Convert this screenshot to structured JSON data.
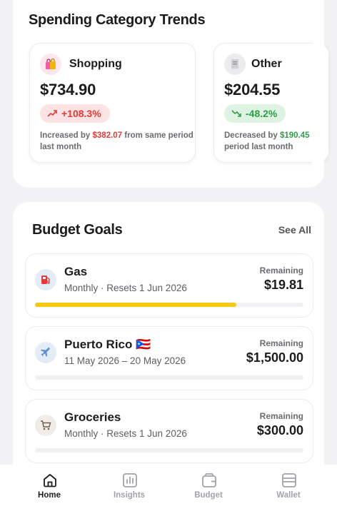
{
  "trends": {
    "title": "Spending Category Trends",
    "cards": [
      {
        "name": "Shopping",
        "icon": "shopping-bags-icon",
        "amount": "$734.90",
        "change": "+108.3%",
        "direction": "up",
        "desc_prefix": "Increased by ",
        "desc_amount": "$382.07",
        "desc_suffix": " from same period last month",
        "accent": "#e53935",
        "pill_bg": "#fde3e3"
      },
      {
        "name": "Other",
        "icon": "receipt-icon",
        "amount": "$204.55",
        "change": "-48.2%",
        "direction": "down",
        "desc_prefix": "Decreased by ",
        "desc_amount": "$190.45",
        "desc_suffix": " period last month",
        "accent": "#2e9e48",
        "pill_bg": "#dff3e3"
      }
    ]
  },
  "budget": {
    "title": "Budget Goals",
    "see_all": "See All",
    "goals": [
      {
        "name": "Gas",
        "icon": "fuel-pump-icon",
        "subtitle": "Monthly · Resets 1 Jun 2026",
        "remaining_label": "Remaining",
        "remaining": "$19.81",
        "progress": 0.75,
        "bar_color": "#f6c915"
      },
      {
        "name": "Puerto Rico 🇵🇷",
        "icon": "airplane-icon",
        "subtitle": "11 May 2026 – 20 May 2026",
        "remaining_label": "Remaining",
        "remaining": "$1,500.00",
        "progress": 0
      },
      {
        "name": "Groceries",
        "icon": "shopping-cart-icon",
        "subtitle": "Monthly · Resets 1 Jun 2026",
        "remaining_label": "Remaining",
        "remaining": "$300.00",
        "progress": 0
      }
    ]
  },
  "tabbar": {
    "tabs": [
      {
        "label": "Home",
        "icon": "home-icon",
        "active": true
      },
      {
        "label": "Insights",
        "icon": "bar-chart-icon",
        "active": false
      },
      {
        "label": "Budget",
        "icon": "wallet-budget-icon",
        "active": false
      },
      {
        "label": "Wallet",
        "icon": "wallet-icon",
        "active": false
      }
    ]
  }
}
